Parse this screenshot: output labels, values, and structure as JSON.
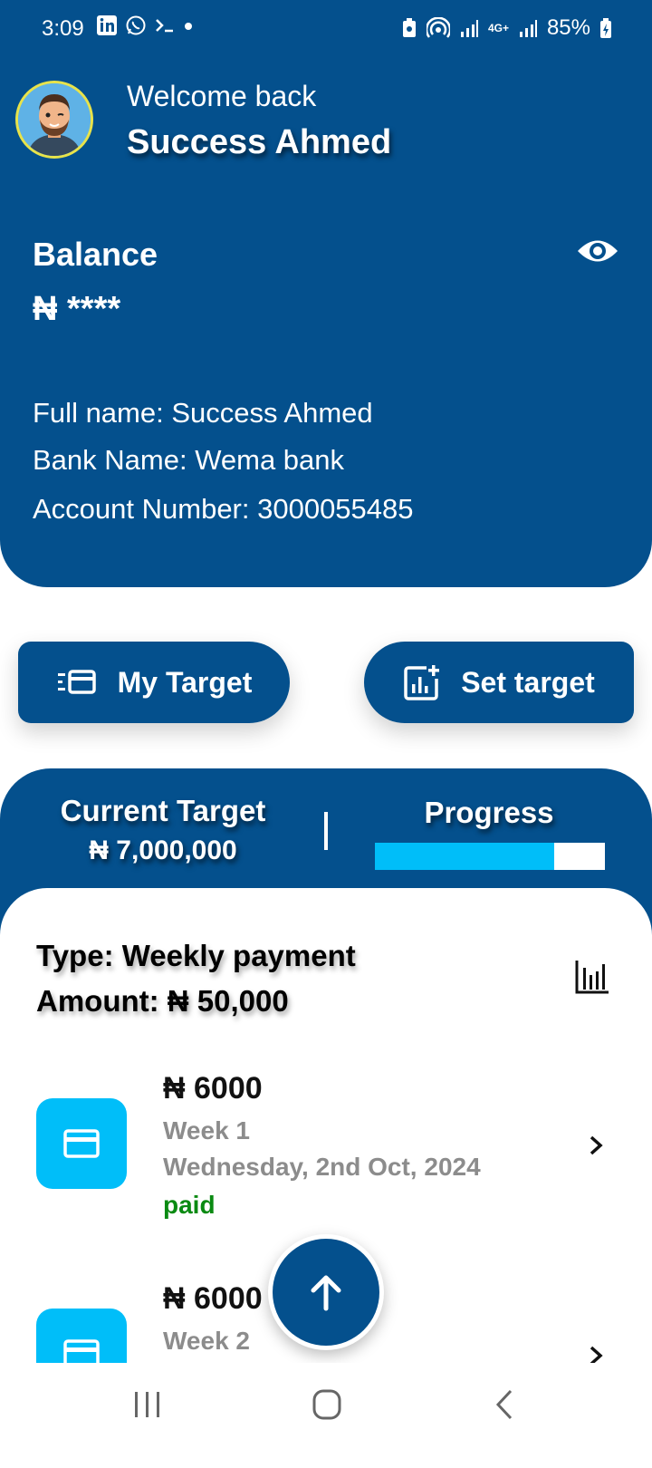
{
  "status_bar": {
    "time": "3:09",
    "battery": "85%",
    "network": "4G+"
  },
  "header": {
    "welcome": "Welcome back",
    "user_name": "Success Ahmed",
    "balance_label": "Balance",
    "balance_value": "₦ ****",
    "full_name": "Full name: Success Ahmed",
    "bank_name": "Bank Name: Wema bank",
    "account_number": "Account Number: 3000055485"
  },
  "actions": {
    "my_target": "My Target",
    "set_target": "Set target"
  },
  "target": {
    "current_label": "Current Target",
    "current_value": "₦ 7,000,000",
    "progress_label": "Progress",
    "progress_fraction": 0.78
  },
  "plan": {
    "type": "Type: Weekly payment",
    "amount": "Amount: ₦ 50,000"
  },
  "payments": [
    {
      "amount": "₦ 6000",
      "week": "Week 1",
      "date": "Wednesday, 2nd Oct, 2024",
      "status": "paid"
    },
    {
      "amount": "₦ 6000",
      "week": "Week 2"
    }
  ],
  "colors": {
    "primary": "#04508d",
    "accent": "#00bef9",
    "paid": "#0a8a12"
  }
}
